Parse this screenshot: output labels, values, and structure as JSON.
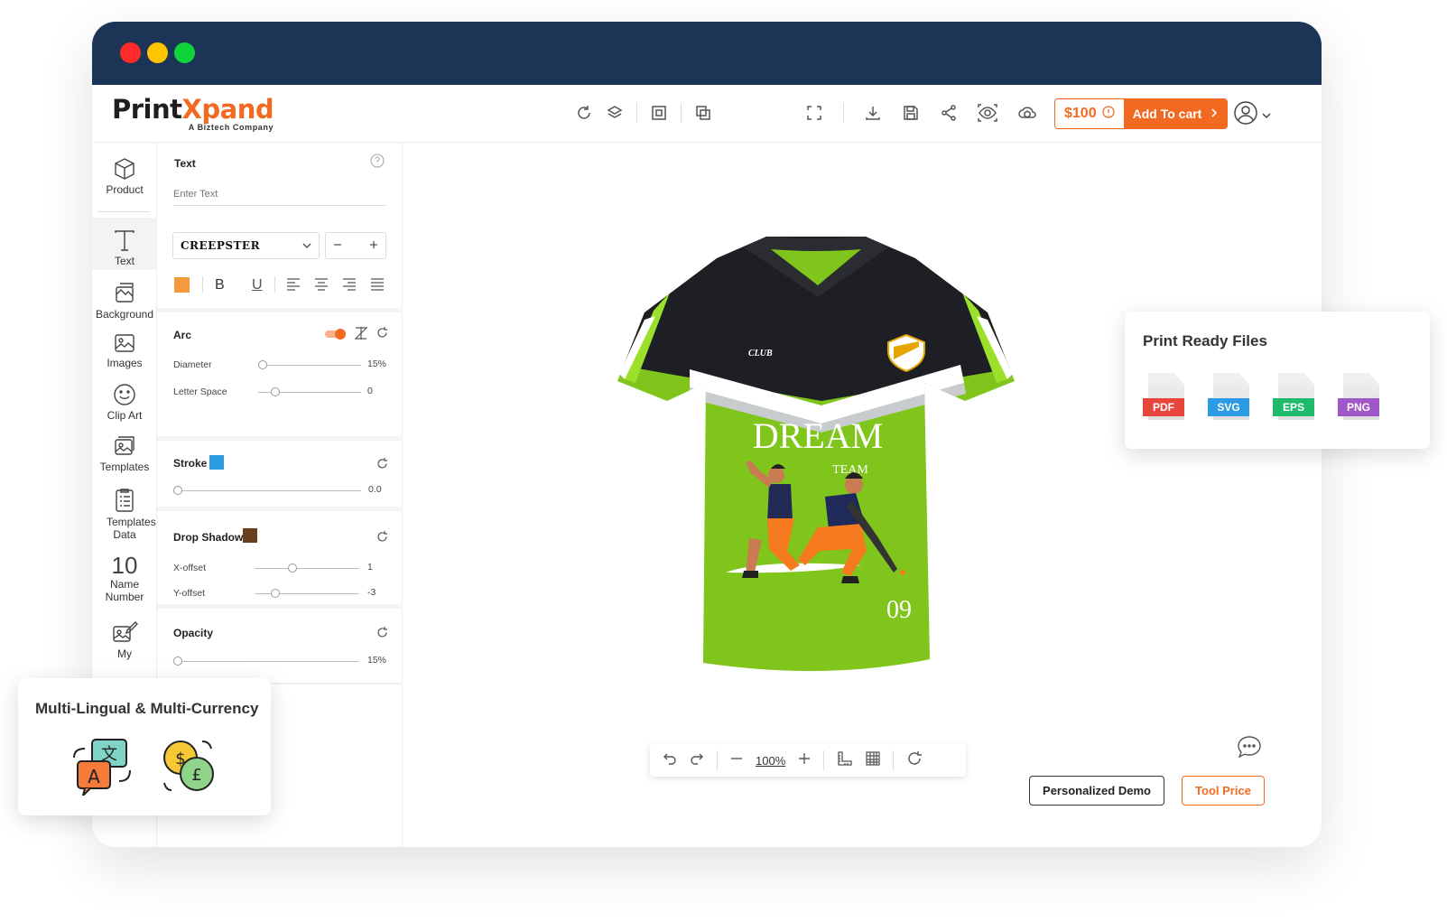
{
  "logo": {
    "print": "Print",
    "x": "X",
    "pand": "pand",
    "tagline": "A Biztech Company"
  },
  "header": {
    "price": "$100",
    "add_to_cart": "Add To cart"
  },
  "sidebar": {
    "items": [
      {
        "label": "Product",
        "icon": "cube-icon"
      },
      {
        "label": "Text",
        "icon": "text-icon"
      },
      {
        "label": "Background",
        "icon": "background-icon"
      },
      {
        "label": "Images",
        "icon": "image-icon"
      },
      {
        "label": "Clip Art",
        "icon": "smiley-icon"
      },
      {
        "label": "Templates",
        "icon": "templates-icon"
      },
      {
        "label": "Templates Data",
        "icon": "templates-data-icon"
      },
      {
        "label": "Name Number",
        "icon": "name-number-icon",
        "glyph": "10"
      },
      {
        "label": "My",
        "icon": "my-designs-icon"
      }
    ]
  },
  "panel": {
    "text": {
      "title": "Text",
      "placeholder": "Enter Text"
    },
    "font": {
      "name": "CREEPSTER"
    },
    "colors": {
      "text": "#f59a3c",
      "stroke": "#2d9be3",
      "shadow": "#6b3e1c"
    },
    "format": {
      "bold": "B",
      "underline": "U"
    },
    "arc": {
      "title": "Arc",
      "diameter_label": "Diameter",
      "diameter_value": "15%",
      "letter_space_label": "Letter Space",
      "letter_space_value": "0"
    },
    "stroke": {
      "title": "Stroke",
      "value": "0.0"
    },
    "shadow": {
      "title": "Drop Shadow",
      "x_label": "X-offset",
      "x_value": "1",
      "y_label": "Y-offset",
      "y_value": "-3"
    },
    "opacity": {
      "title": "Opacity",
      "value": "15%"
    }
  },
  "design": {
    "club": "CLUB",
    "line1": "DREAM",
    "line2": "TEAM",
    "number": "09"
  },
  "zoom": {
    "level": "100%"
  },
  "popups": {
    "print_ready": {
      "title": "Print Ready Files",
      "files": [
        {
          "label": "PDF",
          "color": "#e8453c"
        },
        {
          "label": "SVG",
          "color": "#2d9be3"
        },
        {
          "label": "EPS",
          "color": "#1fba6b"
        },
        {
          "label": "PNG",
          "color": "#a057c7"
        }
      ]
    },
    "multilingual": {
      "title": "Multi-Lingual & Multi-Currency",
      "translate_a": "A",
      "translate_x": "文",
      "dollar": "$",
      "pound": "£"
    }
  },
  "buttons": {
    "demo": "Personalized Demo",
    "tool_price": "Tool Price"
  }
}
